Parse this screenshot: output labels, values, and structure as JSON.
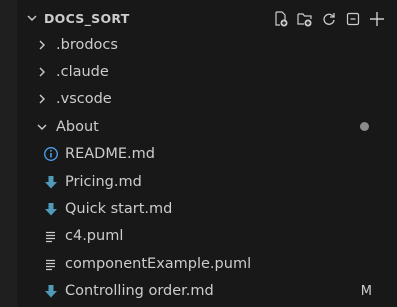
{
  "header": {
    "title": "DOCS_SORT",
    "actions": [
      {
        "icon": "new-file-icon"
      },
      {
        "icon": "new-folder-icon"
      },
      {
        "icon": "refresh-icon"
      },
      {
        "icon": "collapse-all-icon"
      },
      {
        "icon": "plus-icon"
      }
    ]
  },
  "tree": {
    "folders": [
      {
        "label": ".brodocs",
        "state": "collapsed"
      },
      {
        "label": ".claude",
        "state": "collapsed"
      },
      {
        "label": ".vscode",
        "state": "collapsed"
      },
      {
        "label": "About",
        "state": "expanded"
      }
    ],
    "files": [
      {
        "label": "README.md",
        "icon": "info-icon"
      },
      {
        "label": "Pricing.md",
        "icon": "markdown-arrow-icon"
      },
      {
        "label": "Quick start.md",
        "icon": "markdown-arrow-icon"
      },
      {
        "label": "c4.puml",
        "icon": "lines-icon"
      },
      {
        "label": "componentExample.puml",
        "icon": "lines-icon"
      },
      {
        "label": "Controlling order.md",
        "icon": "markdown-arrow-icon",
        "badge": "M"
      }
    ]
  },
  "colors": {
    "background": "#181818",
    "text": "#cccccc",
    "info_icon": "#4ea2f0",
    "markdown_icon": "#519aba",
    "dot": "#8b8b8b"
  }
}
